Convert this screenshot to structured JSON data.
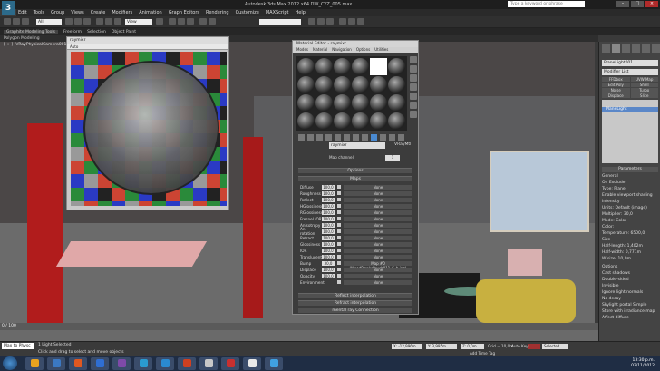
{
  "app": {
    "title": "Autodesk 3ds Max 2012 x64    DW_CYZ_005.max",
    "logo_letter": "3",
    "search_placeholder": "Type a keyword or phrase"
  },
  "menu": [
    "Edit",
    "Tools",
    "Group",
    "Views",
    "Create",
    "Modifiers",
    "Animation",
    "Graph Editors",
    "Rendering",
    "Customize",
    "MAXScript",
    "Help"
  ],
  "toolbar": {
    "selection_filter": "All",
    "view_dropdown": "View"
  },
  "ribbon": {
    "title": "Graphite Modeling Tools",
    "tabs": [
      "Freeform",
      "Selection",
      "Object Paint"
    ],
    "sub": "Polygon Modeling"
  },
  "viewport": {
    "label": "[ + ] [VRayPhysicalCamera001] [ Sha"
  },
  "render_window": {
    "title": "raymixr",
    "tab": "Auto"
  },
  "material_editor": {
    "title": "Material Editor - raymixr",
    "menu": [
      "Modes",
      "Material",
      "Navigation",
      "Options",
      "Utilities"
    ],
    "name": "raymixr",
    "type": "VRayMtl",
    "map_channel_label": "Map channel:",
    "map_channel_value": "1",
    "rollouts": {
      "options": "Options",
      "maps": "Maps",
      "reflect_interp": "Reflect interpolation",
      "refract_interp": "Refract interpolation",
      "mental_ray": "mental ray Connection"
    },
    "maps": [
      {
        "name": "Diffuse",
        "value": "100,0",
        "map": "None"
      },
      {
        "name": "Roughness",
        "value": "100,0",
        "map": "None"
      },
      {
        "name": "Reflect",
        "value": "100,0",
        "map": "None"
      },
      {
        "name": "HGlossiness",
        "value": "100,0",
        "map": "None"
      },
      {
        "name": "RGlossiness",
        "value": "100,0",
        "map": "None"
      },
      {
        "name": "Fresnel IOR",
        "value": "100,0",
        "map": "None"
      },
      {
        "name": "Anisotropy",
        "value": "100,0",
        "map": "None"
      },
      {
        "name": "An. rotation",
        "value": "100,0",
        "map": "None"
      },
      {
        "name": "Refract",
        "value": "100,0",
        "map": "None"
      },
      {
        "name": "Glossiness",
        "value": "100,0",
        "map": "None"
      },
      {
        "name": "IOR",
        "value": "100,0",
        "map": "None"
      },
      {
        "name": "Translucent",
        "value": "100,0",
        "map": "None"
      },
      {
        "name": "Bump",
        "value": "30,0",
        "map": "Map #0 (WoodPlanksBrush011_S_b.jpg)"
      },
      {
        "name": "Displace",
        "value": "100,0",
        "map": "None"
      },
      {
        "name": "Opacity",
        "value": "100,0",
        "map": "None"
      },
      {
        "name": "Environment",
        "value": "",
        "map": "None"
      }
    ]
  },
  "command_panel": {
    "object_name": "PlaneLight001",
    "modifier_list": "Modifier List",
    "buttons": [
      "FFDbox",
      "UVW Map",
      "Edit Poly",
      "Shell",
      "Noise",
      "Turbo",
      "Displace",
      "Slice"
    ],
    "stack_item": "PlaneLight",
    "params_title": "Parameters",
    "params": [
      {
        "label": "General"
      },
      {
        "label": "On        Exclude"
      },
      {
        "label": "Type:  Plane"
      },
      {
        "label": "Enable viewport shading"
      },
      {
        "label": "Intensity"
      },
      {
        "label": "Units:  Default (image)"
      },
      {
        "label": "Multiplier:  30,0"
      },
      {
        "label": "Mode:  Color"
      },
      {
        "label": "Color:"
      },
      {
        "label": "Temperature:  6500,0"
      },
      {
        "label": "Size"
      },
      {
        "label": "Half-length:  1,402m"
      },
      {
        "label": "Half-width:  0,771m"
      },
      {
        "label": "W size:  10,0m"
      },
      {
        "label": "Options"
      },
      {
        "label": "Cast shadows"
      },
      {
        "label": "Double-sided"
      },
      {
        "label": "Invisible"
      },
      {
        "label": "Ignore light normals"
      },
      {
        "label": "No decay"
      },
      {
        "label": "Skylight portal   Simple"
      },
      {
        "label": "Store with irradiance map"
      },
      {
        "label": "Affect diffuse"
      }
    ]
  },
  "timeline": {
    "frame": "0 / 100"
  },
  "status": {
    "mode": "Max to Physc",
    "selected": "1 Light Selected",
    "hint": "Click and drag to select and move objects",
    "x": "X: -12,996m",
    "y": "Y: 3,995m",
    "z": "Z: 0,0m",
    "grid": "Grid = 10,0m",
    "autokey": "Auto Key",
    "selected_btn": "Selected",
    "addtimetag": "Add Time Tag"
  },
  "taskbar": {
    "time": "13:30 p.m.",
    "date": "03/11/2012",
    "apps": [
      "#e8a320",
      "#3b78c2",
      "#e05820",
      "#2f6ed2",
      "#7e4aa8",
      "#2a9ad0",
      "#2a8ad0",
      "#d04020",
      "#c8c8c8",
      "#c83030",
      "#e8e8e8",
      "#40a0e0"
    ]
  }
}
